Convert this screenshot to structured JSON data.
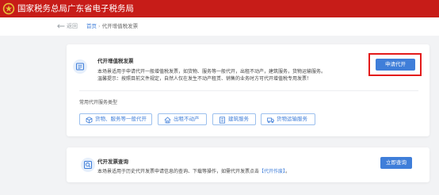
{
  "header": {
    "title": "国家税务总局广东省电子税务局"
  },
  "nav": {
    "back_label": "返回",
    "breadcrumb": {
      "home": "首页",
      "separator": "›",
      "current": "代开增值税发票"
    }
  },
  "card_vat": {
    "title": "代开增值税发票",
    "description": "本场景适用于申请代开一般增值税发票，如货物、服务等一般代开，出租不动产，建筑服务，货物运输服务。",
    "tip": "温馨提示：按照目前文件规定，自然人仅在发生不动产租赁、销售的业务时方可代开增值税专用发票！",
    "apply_button": "申请代开",
    "section_label": "常用代开服务类型",
    "types": [
      {
        "label": "货物、服务等一般代开",
        "icon": "cube-icon"
      },
      {
        "label": "出租不动产",
        "icon": "house-icon"
      },
      {
        "label": "建筑服务",
        "icon": "building-icon"
      },
      {
        "label": "货物运输服务",
        "icon": "truck-icon"
      }
    ]
  },
  "card_query": {
    "title": "代开发票查询",
    "description_before": "本场景适用于历史代开发票申请信息的查询、下载等操作，如需代开发票点击",
    "description_link": "【代开作废】",
    "description_after": "。",
    "query_button": "立即查询"
  },
  "colors": {
    "brand_red": "#c71c18",
    "primary_blue": "#3f7ed9",
    "annotation_red": "#e31b1b"
  }
}
